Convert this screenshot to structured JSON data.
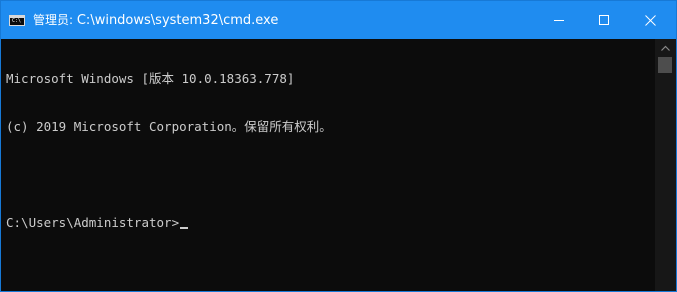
{
  "window": {
    "title_prefix": "管理员: ",
    "title_path": "C:\\windows\\system32\\cmd.exe",
    "app_icon_glyph": "C:\\"
  },
  "console": {
    "lines": [
      "Microsoft Windows [版本 10.0.18363.778]",
      "(c) 2019 Microsoft Corporation。保留所有权利。",
      "",
      "C:\\Users\\Administrator>"
    ]
  },
  "icons": {
    "app": "cmd-terminal-icon",
    "minimize": "minimize-icon",
    "maximize": "maximize-icon",
    "close": "close-icon",
    "scroll_up": "chevron-up-icon"
  },
  "colors": {
    "titlebar": "#1f8cf0",
    "border": "#1779d6",
    "console_bg": "#0c0c0c",
    "console_text": "#cccccc",
    "scrollbar_track": "#171717",
    "scrollbar_thumb": "#4d4d4d"
  }
}
